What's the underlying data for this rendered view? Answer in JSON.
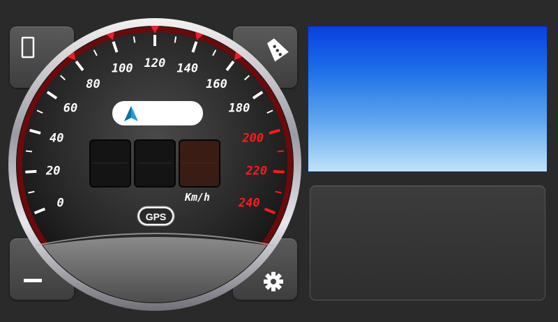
{
  "speedometer": {
    "unit": "Km/h",
    "gps_label": "GPS",
    "ticks": [
      "0",
      "20",
      "40",
      "60",
      "80",
      "100",
      "120",
      "140",
      "160",
      "180",
      "200",
      "220",
      "240"
    ],
    "digits": [
      "",
      "",
      ""
    ],
    "location_text": "",
    "colors": {
      "normal_label": "#ffffff",
      "red_label": "#ff1a1a",
      "marker": "#e8202a"
    }
  },
  "buttons": {
    "top_left_icon": "phone-outline-icon",
    "top_right_icon": "pedestrian-crossing-icon",
    "bottom_left_icon": "minimize-icon",
    "bottom_right_icon": "gear-icon"
  }
}
